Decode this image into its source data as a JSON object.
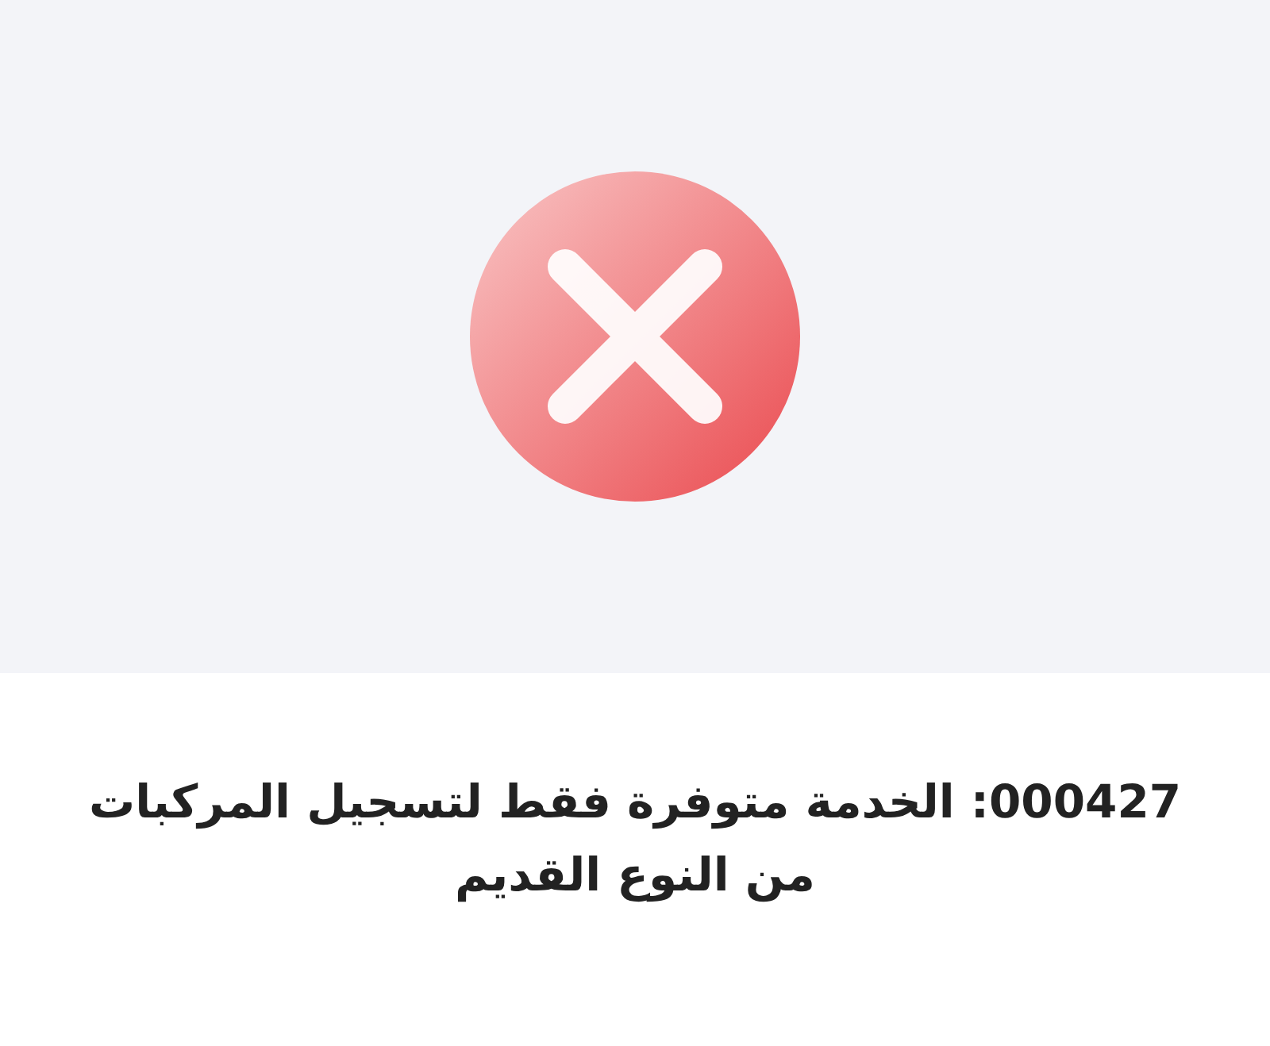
{
  "status": {
    "kind": "error"
  },
  "message": "000427: الخدمة متوفرة فقط لتسجيل المركبات من النوع القديم"
}
